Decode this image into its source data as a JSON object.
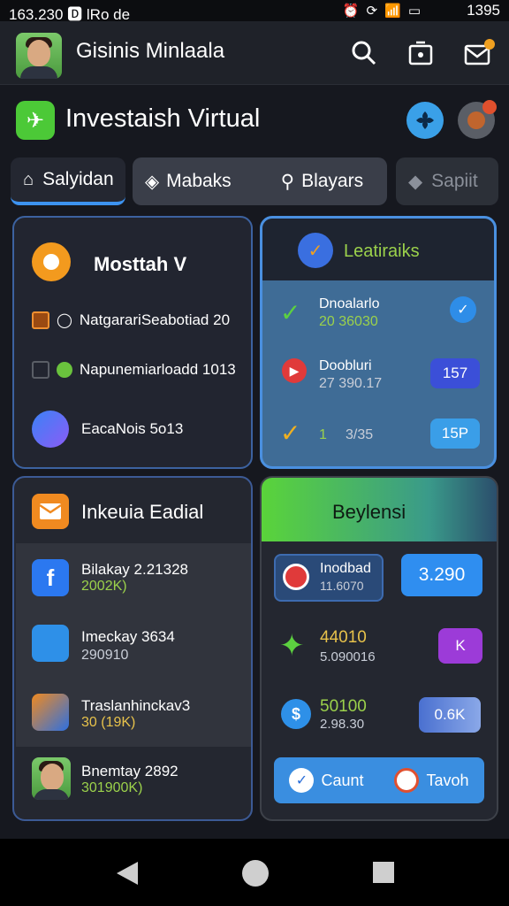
{
  "status_bar": {
    "left_text": "163.230 🅳 lRo de",
    "right_text": "1395"
  },
  "header": {
    "title": "Gisinis Minlaala"
  },
  "section": {
    "title": "Investaish Virtual"
  },
  "tabs": [
    {
      "label": "Salyidan"
    },
    {
      "label": "Mabaks"
    },
    {
      "label": "Blayars"
    },
    {
      "label": "Sapiit"
    }
  ],
  "card_top_left": {
    "title": "Mosttah V",
    "items": [
      {
        "label": "NatgarariSeabotiad 20"
      },
      {
        "label": "Napunemiarloadd 1013"
      },
      {
        "label": "EacaNois 5o13"
      }
    ]
  },
  "card_top_right": {
    "title": "Leatiraiks",
    "rows": [
      {
        "name": "Dnoalarlo",
        "value": "20 36030"
      },
      {
        "name": "Doobluri",
        "value": "27 390.17",
        "badge": "157"
      },
      {
        "name": "1",
        "value": "3/35",
        "badge": "15P"
      }
    ]
  },
  "card_bottom_left": {
    "title": "Inkeuia Eadial",
    "items": [
      {
        "name": "Bilakay 2.21328",
        "value": "2002K)"
      },
      {
        "name": "Imeckay 3634",
        "value": "290910"
      },
      {
        "name": "Traslanhinckav3",
        "value": "30 (19K)"
      },
      {
        "name": "Bnemtay 2892",
        "value": "301900K)"
      }
    ]
  },
  "card_bottom_right": {
    "title": "Beylensi",
    "row1": {
      "name": "Inodbad",
      "value": "11.6070",
      "amount": "3.290"
    },
    "row2": {
      "value": "44010",
      "sub": "5.090016",
      "badge": "K"
    },
    "row3": {
      "value": "50100",
      "sub": "2.98.30",
      "badge": "0.6K"
    },
    "buttons": [
      {
        "label": "Caunt"
      },
      {
        "label": "Tavoh"
      }
    ]
  },
  "colors": {
    "accent": "#3d93f0",
    "green": "#4cc937",
    "card_blue": "#3f6c96"
  }
}
